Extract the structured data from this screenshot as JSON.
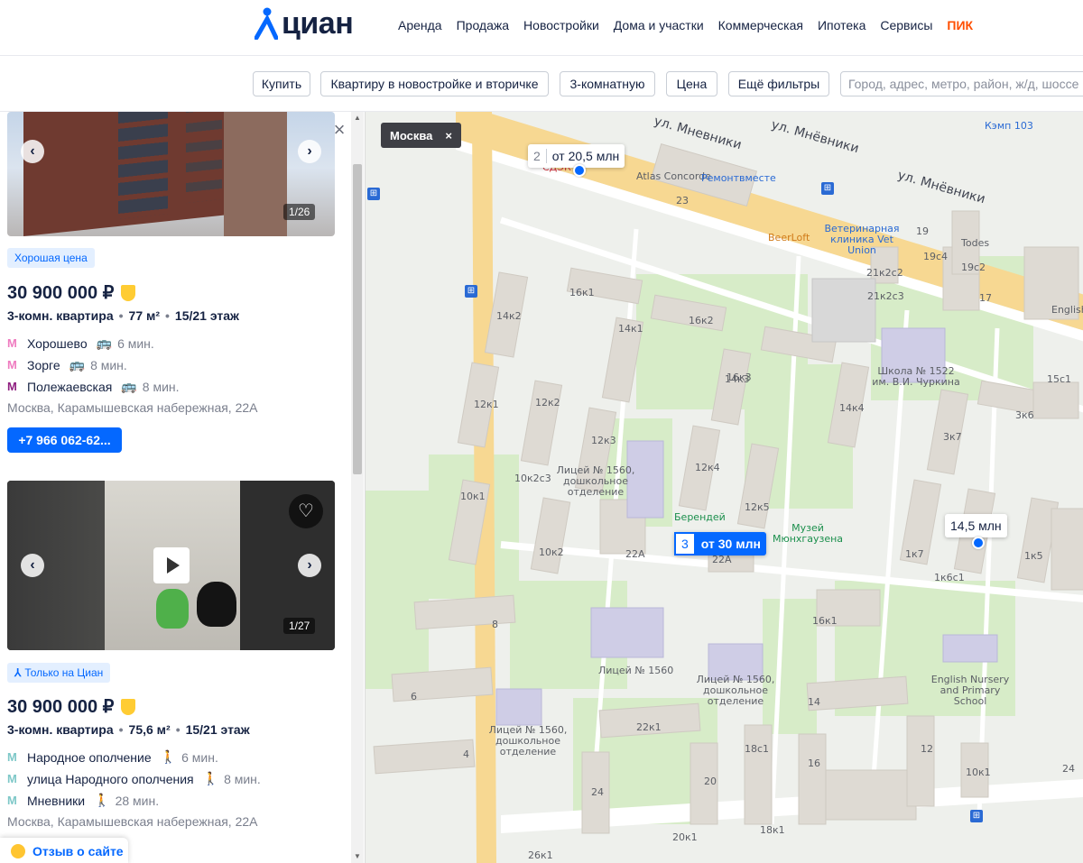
{
  "header": {
    "logo_text": "циан",
    "nav": [
      "Аренда",
      "Продажа",
      "Новостройки",
      "Дома и участки",
      "Коммерческая",
      "Ипотека",
      "Сервисы",
      "ПИК"
    ]
  },
  "filters": {
    "buy": "Купить",
    "type": "Квартиру в новостройке и вторичке",
    "rooms": "3-комнатную",
    "price": "Цена",
    "more": "Ещё фильтры",
    "search_placeholder": "Город, адрес, метро, район, ж/д, шоссе или ЖК"
  },
  "listings": [
    {
      "photo_counter": "1/26",
      "badge": "Хорошая цена",
      "price": "30 900 000 ₽",
      "rooms": "3-комн. квартира",
      "area": "77 м²",
      "floor": "15/21 этаж",
      "metro": [
        {
          "name": "Хорошево",
          "time": "6 мин.",
          "mode": "bus-icon",
          "color": "#ef7cc0"
        },
        {
          "name": "Зорге",
          "time": "8 мин.",
          "mode": "bus-icon",
          "color": "#ef7cc0"
        },
        {
          "name": "Полежаевская",
          "time": "8 мин.",
          "mode": "bus-icon",
          "color": "#8f1f80"
        }
      ],
      "address": "Москва, Карамышевская набережная, 22А",
      "phone": "+7 966 062-62..."
    },
    {
      "photo_counter": "1/27",
      "badge": "Только на Циан",
      "price": "30 900 000 ₽",
      "rooms": "3-комн. квартира",
      "area": "75,6 м²",
      "floor": "15/21 этаж",
      "metro": [
        {
          "name": "Народное ополчение",
          "time": "6 мин.",
          "mode": "walk-icon",
          "color": "#7ec8c8"
        },
        {
          "name": "улица Народного ополчения",
          "time": "8 мин.",
          "mode": "walk-icon",
          "color": "#7ec8c8"
        },
        {
          "name": "Мневники",
          "time": "28 мин.",
          "mode": "walk-icon",
          "color": "#7ec8c8"
        }
      ],
      "address": "Москва, Карамышевская набережная, 22А"
    }
  ],
  "feedback": "Отзыв о сайте",
  "map": {
    "city": "Москва",
    "pins": [
      {
        "count": "2",
        "text": "от 20,5 млн"
      },
      {
        "count": "3",
        "text": "от 30 млн"
      },
      {
        "text": "14,5 млн"
      }
    ],
    "streets": [
      "ул. Мневники",
      "ул. Мнёвники",
      "ул. Мнёвники"
    ],
    "pois": {
      "atlas": "Atlas Concorde",
      "remont": "Ремонтвместе",
      "beerloft": "BeerLoft",
      "vet": "Ветеринарная клиника Vet Union",
      "kemp": "Кэмп 103",
      "todes": "Todes",
      "school1522": "Школа № 1522 им. В.И. Чуркина",
      "lic1560a": "Лицей № 1560, дошкольное отделение",
      "berendey": "Берендей",
      "museum": "Музей Мюнхгаузена",
      "lic1560b": "Лицей № 1560",
      "lic1560c": "Лицей № 1560, дошкольное отделение",
      "lic1560d": "Лицей № 1560, дошкольное отделение",
      "english": "English Nursery and Primary School",
      "english2": "English",
      "cdek": "СДЭК"
    },
    "house_numbers": [
      "23",
      "16к1",
      "16к2",
      "14к1",
      "14к2",
      "16к3",
      "14к3",
      "12к2",
      "12к1",
      "12к3",
      "12к4",
      "12к5",
      "10к2с3",
      "10к1",
      "10к2",
      "22А",
      "22А",
      "8",
      "6",
      "4",
      "22к1",
      "24",
      "20",
      "20к1",
      "18к1",
      "18с1",
      "16",
      "14",
      "16к1",
      "12",
      "10к1",
      "1к7",
      "1к6с1",
      "1к5",
      "3к7",
      "3к6",
      "15с1",
      "17",
      "19",
      "19с4",
      "19с2",
      "21к2с2",
      "21к2с3",
      "14к4",
      "26к1",
      "24"
    ]
  }
}
